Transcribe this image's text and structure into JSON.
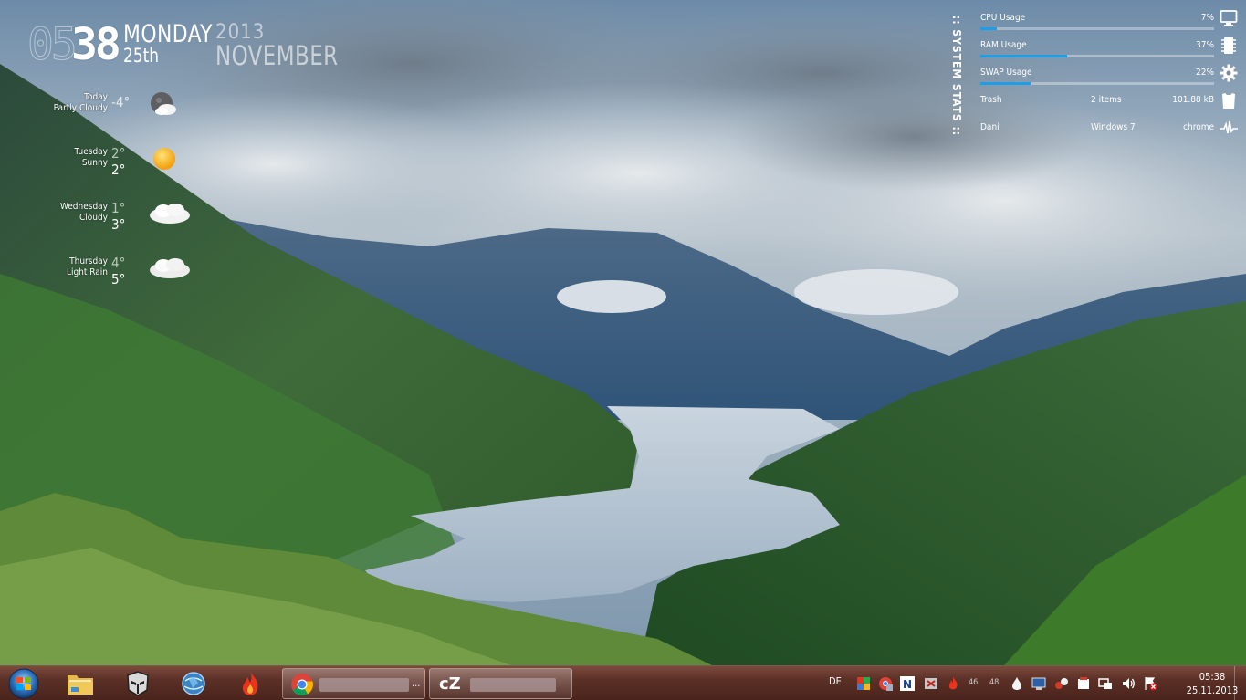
{
  "clock": {
    "hour": "05",
    "minute": "38",
    "weekday": "MONDAY",
    "day": "25th",
    "year": "2013",
    "month": "NOVEMBER"
  },
  "forecast": [
    {
      "day": "Today",
      "condition": "Partly Cloudy",
      "temp_hi": "",
      "temp_lo": "-4°",
      "icon": "moon-cloud-icon"
    },
    {
      "day": "Tuesday",
      "condition": "Sunny",
      "temp_hi": "2°",
      "temp_lo": "2°",
      "icon": "sun-icon"
    },
    {
      "day": "Wednesday",
      "condition": "Cloudy",
      "temp_hi": "1°",
      "temp_lo": "3°",
      "icon": "cloud-icon"
    },
    {
      "day": "Thursday",
      "condition": "Light Rain",
      "temp_hi": "4°",
      "temp_lo": "5°",
      "icon": "cloud-icon"
    }
  ],
  "stats": {
    "title": ":: SYSTEM STATS ::",
    "cpu": {
      "label": "CPU Usage",
      "value": "7%",
      "percent": 7,
      "icon": "monitor-icon"
    },
    "ram": {
      "label": "RAM Usage",
      "value": "37%",
      "percent": 37,
      "icon": "memory-chip-icon"
    },
    "swap": {
      "label": "SWAP Usage",
      "value": "22%",
      "percent": 22,
      "icon": "gear-icon"
    },
    "trash": {
      "label": "Trash",
      "items": "2 items",
      "size": "101.88 kB",
      "icon": "trash-icon"
    },
    "system": {
      "user": "Dani",
      "os": "Windows 7",
      "process": "chrome",
      "icon": "pulse-icon"
    }
  },
  "taskbar": {
    "tasks": [
      {
        "app": "chrome",
        "ellipsis": "..."
      },
      {
        "app": "cz",
        "label": "cZ"
      }
    ],
    "tray": {
      "language": "DE",
      "temp_a": "46",
      "temp_b": "48",
      "time": "05:38",
      "date": "25.11.2013"
    }
  },
  "colors": {
    "accent_bar": "#1f9ee8",
    "taskbar": "#5b3026"
  }
}
